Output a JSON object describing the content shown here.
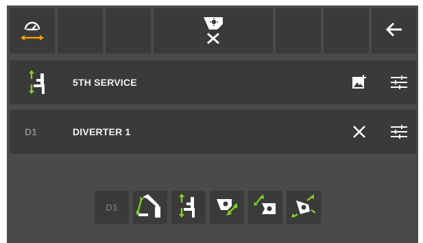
{
  "toolbar": {
    "left_icon": "speed-horizontal-icon",
    "center_icon": "bucket-cancel-icon",
    "back_icon": "back-arrow-icon"
  },
  "rows": [
    {
      "label": "5TH SERVICE",
      "icon": "fifth-service-icon",
      "actions": [
        "image-add-icon",
        "sliders-icon"
      ]
    },
    {
      "tag": "D1",
      "label": "DIVERTER 1",
      "actions": [
        "close-icon",
        "sliders-icon"
      ]
    }
  ],
  "options": {
    "d1_label": "D1",
    "items": [
      "boom-arm-icon",
      "fifth-service-icon",
      "bucket-tilt-icon",
      "bucket-rotate-icon",
      "bucket-swivel-icon"
    ]
  },
  "colors": {
    "accent": "#f5a000",
    "arrow_green": "#7ed321",
    "panel_dark": "#3a3a3a",
    "panel_mid": "#4a4a4a"
  }
}
